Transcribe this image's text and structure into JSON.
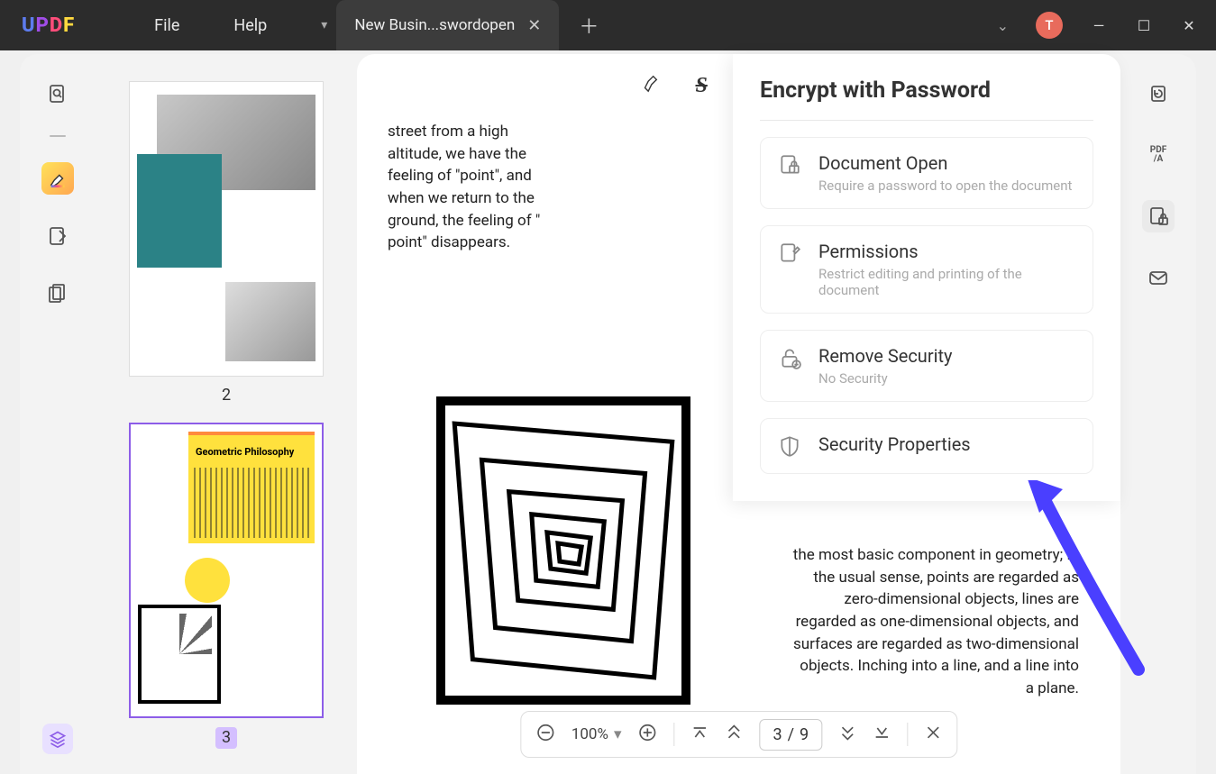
{
  "menu": {
    "file": "File",
    "help": "Help"
  },
  "tab": {
    "title": "New Busin...swordopen"
  },
  "avatar": "T",
  "leftbar": [
    "search",
    "comment",
    "edit",
    "pages"
  ],
  "thumbs": {
    "page2": "2",
    "page3": "3"
  },
  "doc": {
    "text1": "street from a high altitude, we have the feeling of \"point\", and when we return to the ground, the feeling of \" point\" disappears.",
    "text2": "the most basic component in geometry; in the usual sense, points are regarded as zero-dimensional objects, lines are regarded as one-dimensional objects, and surfaces are regarded as two-dimensional objects. Inching into a line, and a line into a plane.",
    "thumb3_title": "Geometric Philosophy"
  },
  "zoom": {
    "value": "100%",
    "page_current": "3",
    "page_sep": "/",
    "page_total": "9"
  },
  "encrypt": {
    "title": "Encrypt with Password",
    "items": [
      {
        "label": "Document Open",
        "desc": "Require a password to open the document"
      },
      {
        "label": "Permissions",
        "desc": "Restrict editing and printing of the document"
      },
      {
        "label": "Remove Security",
        "desc": "No Security"
      },
      {
        "label": "Security Properties",
        "desc": ""
      }
    ]
  }
}
